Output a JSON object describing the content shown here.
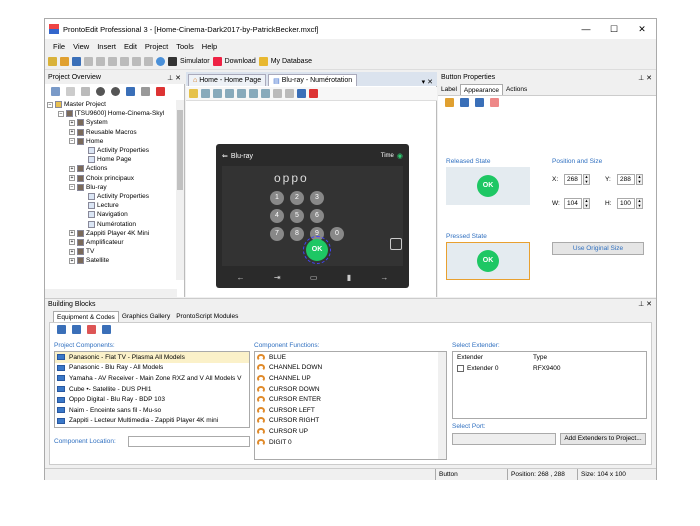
{
  "app": {
    "title": "ProntoEdit Professional 3 - [Home-Cinema-Dark2017-by-PatrickBecker.mxcf]"
  },
  "menu": [
    "File",
    "View",
    "Insert",
    "Edit",
    "Project",
    "Tools",
    "Help"
  ],
  "toolbar": {
    "simulator": "Simulator",
    "download": "Download",
    "my_database": "My Database"
  },
  "project_overview": {
    "title": "Project Overview",
    "tree": [
      {
        "label": "Master Project",
        "indent": 0,
        "pm": "−"
      },
      {
        "label": "[TSU9600] Home-Cinema-Skyl",
        "indent": 1,
        "pm": "−"
      },
      {
        "label": "System",
        "indent": 2,
        "pm": "+"
      },
      {
        "label": "Reusable Macros",
        "indent": 2,
        "pm": "+"
      },
      {
        "label": "Home",
        "indent": 2,
        "pm": "−"
      },
      {
        "label": "Activity Properties",
        "indent": 3,
        "pm": ""
      },
      {
        "label": "Home Page",
        "indent": 3,
        "pm": ""
      },
      {
        "label": "Actions",
        "indent": 2,
        "pm": "+"
      },
      {
        "label": "Choix principaux",
        "indent": 2,
        "pm": "+"
      },
      {
        "label": "Blu-ray",
        "indent": 2,
        "pm": "−"
      },
      {
        "label": "Activity Properties",
        "indent": 3,
        "pm": ""
      },
      {
        "label": "Lecture",
        "indent": 3,
        "pm": ""
      },
      {
        "label": "Navigation",
        "indent": 3,
        "pm": ""
      },
      {
        "label": "Numérotation",
        "indent": 3,
        "pm": ""
      },
      {
        "label": "Zappiti Player 4K Mini",
        "indent": 2,
        "pm": "+"
      },
      {
        "label": "Amplificateur",
        "indent": 2,
        "pm": "+"
      },
      {
        "label": "TV",
        "indent": 2,
        "pm": "+"
      },
      {
        "label": "Satellite",
        "indent": 2,
        "pm": "+"
      }
    ]
  },
  "document": {
    "tabs": [
      "Home - Home Page",
      "Blu-ray - Numérotation"
    ],
    "device": {
      "source_label": "Blu-ray",
      "time_label": "Time",
      "brand": "oppo",
      "ok": "OK",
      "keys": [
        "1",
        "2",
        "3",
        "4",
        "5",
        "6",
        "7",
        "8",
        "9",
        "0"
      ]
    }
  },
  "button_properties": {
    "title": "Button Properties",
    "tabs": [
      "Label",
      "Appearance",
      "Actions"
    ],
    "released_state": "Released State",
    "pressed_state": "Pressed State",
    "position_and_size": "Position and Size",
    "ok": "OK",
    "x_label": "X:",
    "x": "268",
    "y_label": "Y:",
    "y": "288",
    "w_label": "W:",
    "w": "104",
    "h_label": "H:",
    "h": "100",
    "use_original": "Use Original Size"
  },
  "building_blocks": {
    "title": "Building Blocks",
    "tabs": [
      "Equipment & Codes",
      "Graphics Gallery",
      "ProntoScript Modules"
    ],
    "project_components_label": "Project Components:",
    "components": [
      "Panasonic - Flat TV - Plasma All Models",
      "Panasonic - Blu Ray - All Models",
      "Yamaha - AV Receiver - Main Zone RXZ and V All Models V",
      "Cube •- Satellite - DUS PHI1",
      "Oppo Digital - Blu Ray - BDP 103",
      "Naim - Enceinte sans fil - Mu-so",
      "Zappiti - Lecteur Multimedia - Zappiti Player 4K mini"
    ],
    "component_location_label": "Component Location:",
    "component_functions_label": "Component Functions:",
    "functions": [
      "BLUE",
      "CHANNEL DOWN",
      "CHANNEL UP",
      "CURSOR DOWN",
      "CURSOR ENTER",
      "CURSOR LEFT",
      "CURSOR RIGHT",
      "CURSOR UP",
      "DIGIT 0"
    ],
    "select_extender_label": "Select Extender:",
    "extender_col": "Extender",
    "type_col": "Type",
    "extender_name": "Extender 0",
    "extender_type": "RFX9400",
    "select_port_label": "Select Port:",
    "add_extenders": "Add Extenders to Project..."
  },
  "status": {
    "item": "Button",
    "position": "Position: 268 , 288",
    "size": "Size: 104 x 100"
  }
}
